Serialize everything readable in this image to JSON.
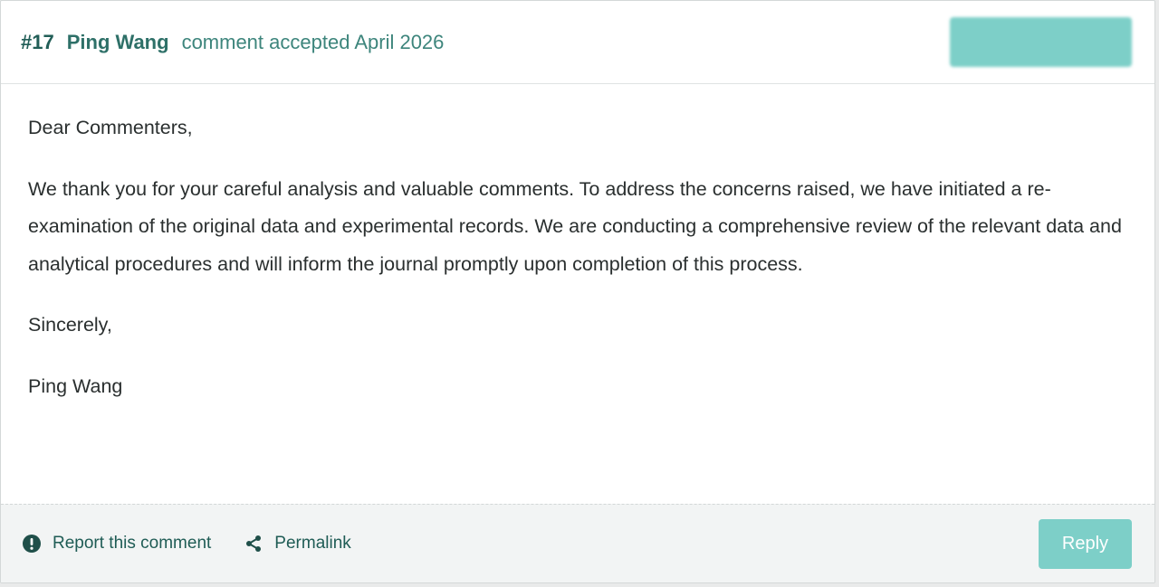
{
  "comment": {
    "number": "#17",
    "author": "Ping Wang",
    "status": "comment accepted April 2026",
    "paragraphs": {
      "greeting": "Dear Commenters,",
      "main": "We thank you for your careful analysis and valuable comments. To address the concerns raised, we have initiated a re-examination of the original data and experimental records. We are conducting a comprehensive review of the relevant data and analytical procedures and will inform the journal promptly upon completion of this process.",
      "closing": "Sincerely,",
      "signature": "Ping Wang"
    }
  },
  "footer": {
    "report_label": "Report this comment",
    "permalink_label": "Permalink",
    "reply_label": "Reply"
  },
  "colors": {
    "accent": "#7dcfc8",
    "author_text": "#2e7068",
    "status_text": "#3d857c",
    "footer_text": "#1f5c55",
    "body_text": "#2a2f2f"
  },
  "icons": {
    "report": "exclamation-circle-icon",
    "permalink": "share-icon"
  }
}
